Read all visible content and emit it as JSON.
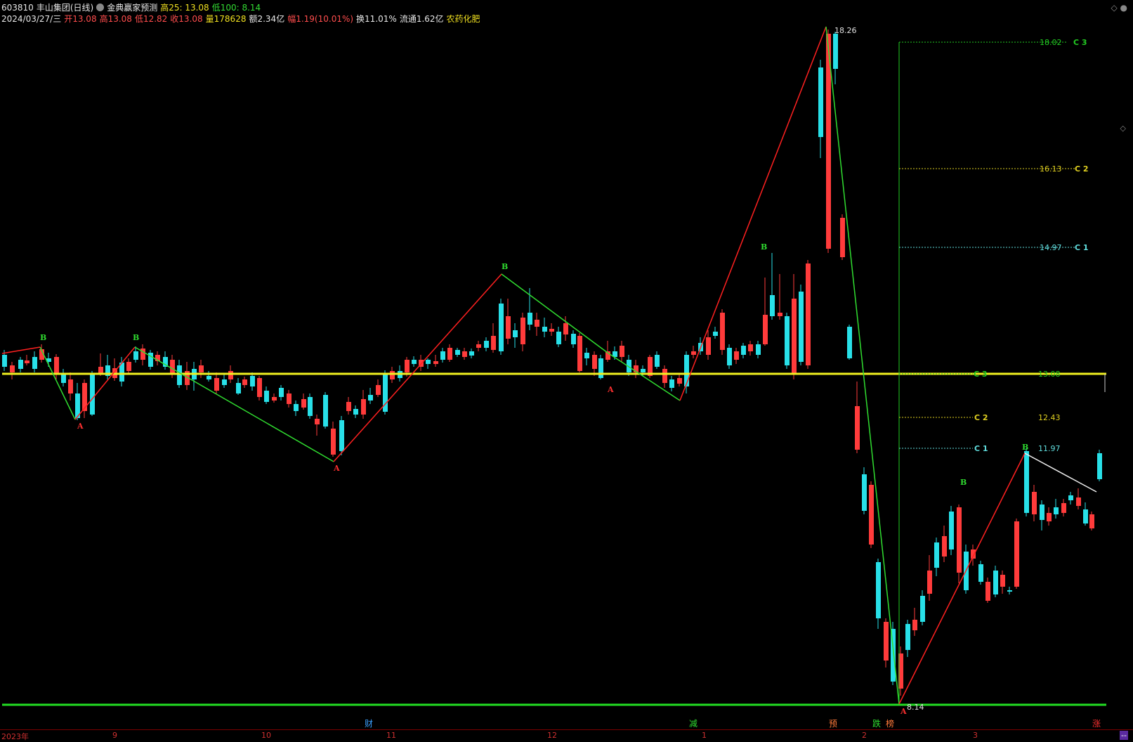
{
  "header": {
    "code": "603810",
    "name": "丰山集团(日线)",
    "indicator": "金典赢家预测",
    "high25": "高25: 13.08",
    "low100": "低100: 8.14",
    "date": "2024/03/27/三",
    "open": "开13.08",
    "high": "高13.08",
    "low": "低12.82",
    "close": "收13.08",
    "volume": "量178628",
    "amount": "额2.34亿",
    "change": "幅1.19(10.01%)",
    "turnover": "换11.01%",
    "float": "流通1.62亿",
    "sector": "农药化肥"
  },
  "chart": {
    "labels": {
      "high_price": "18.26",
      "low_price": "8.14",
      "c3_top": "18.02",
      "c2_top": "16.13",
      "c1_top": "14.97",
      "c3_mid": "13.08",
      "c2_mid": "12.43",
      "c1_mid": "11.97",
      "c3": "C 3",
      "c2": "C 2",
      "c1": "C 1",
      "a": "A",
      "b": "B"
    },
    "events": [
      "财",
      "减",
      "预",
      "跌",
      "榜",
      "涨"
    ]
  },
  "datebar": {
    "year": "2023年",
    "months": [
      "9",
      "10",
      "11",
      "12",
      "1",
      "2",
      "3"
    ],
    "corner": "--"
  },
  "colors": {
    "up": "#ff3b3b",
    "down": "#28e0e8",
    "zig_up": "#ff2020",
    "zig_down": "#30dd30",
    "yellow_line": "#f0f020",
    "green_line": "#22dd22"
  }
}
